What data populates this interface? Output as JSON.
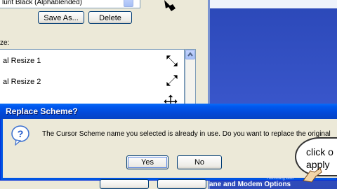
{
  "mouse_props": {
    "scheme_combo_text": "lunt Black (Alphablended)",
    "save_as_label": "Save As...",
    "delete_label": "Delete",
    "customize_label": "ze:",
    "list_items": [
      {
        "label": "al Resize 1",
        "icon": "diagonal-resize-1-icon"
      },
      {
        "label": "al Resize 2",
        "icon": "diagonal-resize-2-icon"
      },
      {
        "label": "",
        "icon": "move-icon"
      }
    ]
  },
  "dialog": {
    "title": "Replace Scheme?",
    "message": "The Cursor Scheme name you selected is already in use.  Do you want to replace the original",
    "yes_label": "Yes",
    "no_label": "No"
  },
  "desktop": {
    "caption": "ane and Modem Options",
    "caption_sub": "Humming Bird"
  },
  "bubble": {
    "line1": "click o",
    "line2": "apply"
  }
}
